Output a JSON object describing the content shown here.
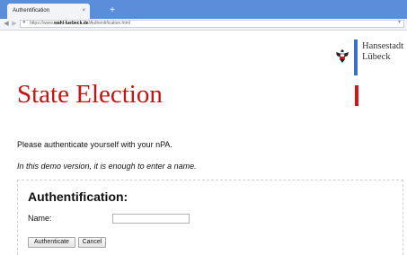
{
  "browser": {
    "tab": {
      "title": "Authentification",
      "close_glyph": "×"
    },
    "new_tab_glyph": "+",
    "nav": {
      "back_icon": "back-arrow-icon",
      "forward_icon": "forward-arrow-icon"
    },
    "url": {
      "prefix": "https://www.",
      "domain": "wahl-luebeck.de",
      "path": "/Authentification.html"
    }
  },
  "logo": {
    "emblem_icon": "lubeck-eagle-icon",
    "line1": "Hansestadt",
    "line2": "Lübeck",
    "accent_color": "#3b6fbf"
  },
  "page": {
    "title": "State Election",
    "title_color": "#cc1111",
    "intro": "Please authenticate yourself with your nPA.",
    "demo_note": "In this demo version, it is enough to enter a name."
  },
  "auth_form": {
    "heading": "Authentification:",
    "name_label": "Name:",
    "name_value": "",
    "authenticate_label": "Authenticate",
    "cancel_label": "Cancel"
  }
}
